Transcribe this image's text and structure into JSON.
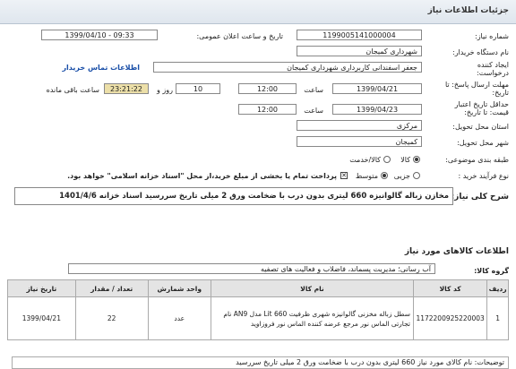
{
  "header": {
    "title": "جزئیات اطلاعات نیاز"
  },
  "fields": {
    "need_number_label": "شماره نیاز:",
    "need_number": "1199005141000004",
    "announce_label": "تاریخ و ساعت اعلان عمومی:",
    "announce_value": "1399/04/10 - 09:33",
    "buyer_label": "نام دستگاه خریدار:",
    "buyer_value": "شهرداری کمیجان",
    "creator_label": "ایجاد کننده درخواست:",
    "creator_value": "جعفر  اسفندانی  کاربرداری شهرداری کمیجان",
    "contact_link": "اطلاعات تماس خریدار",
    "deadline_label": "مهلت ارسال پاسخ: تا تاریخ:",
    "deadline_date": "1399/04/21",
    "time_label": "ساعت",
    "deadline_time": "12:00",
    "days_value": "10",
    "days_label": "روز و",
    "remaining_time": "23:21:22",
    "remaining_label": "ساعت باقی مانده",
    "validity_label": "حداقل تاریخ اعتبار قیمت: تا تاریخ:",
    "validity_date": "1399/04/23",
    "validity_time_label": "ساعت",
    "validity_time": "12:00",
    "province_label": "استان محل تحویل:",
    "province_value": "مرکزی",
    "city_label": "شهر محل تحویل:",
    "city_value": "کمیجان",
    "category_label": "طبقه بندی موضوعی:",
    "category_options": [
      "کالا",
      "کالا/خدمت"
    ],
    "process_label": "نوع فرآیند خرید :",
    "process_options": [
      "جزیی",
      "متوسط"
    ],
    "payment_note": "پرداخت تمام یا بخشی از مبلغ خرید،از محل \"اسناد خزانه اسلامی\" خواهد بود."
  },
  "description": {
    "label": "شرح کلی نیاز:",
    "value": "مخازن زباله گالوانیزه 660 لیتری بدون درب با ضخامت ورق 2 میلی  تاریخ سررسید اسناد خزانه 1401/4/6"
  },
  "goods_section": {
    "title": "اطلاعات کالاهای مورد نیاز"
  },
  "goods_group": {
    "label": "گروه کالا:",
    "value": "آب رسانی؛ مدیریت پسماند، فاضلاب و فعالیت های تصفیه"
  },
  "table": {
    "headers": [
      "ردیف",
      "کد کالا",
      "نام کالا",
      "واحد شمارش",
      "تعداد / مقدار",
      "تاریخ نیاز"
    ],
    "rows": [
      {
        "row": "1",
        "code": "1172200925220003",
        "name": "سطل زباله مخزنی گالوانیزه شهری ظرفیت 660 Lit مدل AN9 نام تجارتی الماس نور مرجع عرضه کننده الماس نور فروزاوید",
        "unit": "عدد",
        "qty": "22",
        "date": "1399/04/21"
      }
    ]
  },
  "footer_partial": "توضیحات: نام کالای مورد نیاز 660 لیتری بدون درب با ضخامت ورق 2 میلی تاریخ سررسید"
}
